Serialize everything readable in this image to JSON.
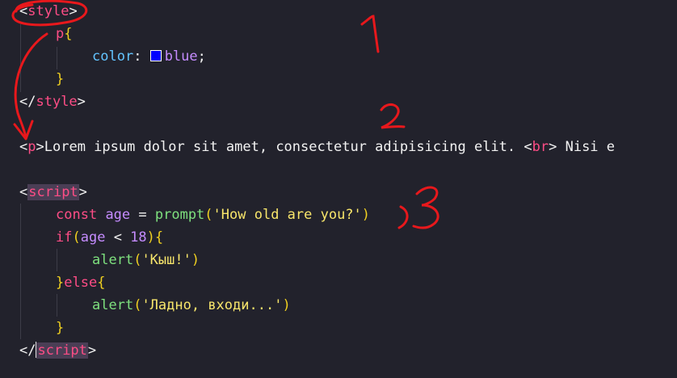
{
  "code": {
    "style_open_tag": "style",
    "selector": "p",
    "brace_open": "{",
    "property": "color",
    "colon": ":",
    "value": "blue",
    "semicolon": ";",
    "brace_close": "}",
    "style_close_tag": "style",
    "p_tag": "p",
    "paragraph_text_1": "Lorem ipsum dolor sit amet, consectetur adipisicing elit. ",
    "br_tag": "br",
    "paragraph_text_2": " Nisi e",
    "script_open_tag": "script",
    "const_kw": "const",
    "age_var": "age",
    "equals": " = ",
    "prompt_fn": "prompt",
    "prompt_arg": "'How old are you?'",
    "if_kw": "if",
    "less_than": " < ",
    "age_limit": "18",
    "alert_fn": "alert",
    "alert_arg_1": "'Кыш!'",
    "else_kw": "else",
    "alert_arg_2": "'Ладно, входи...'",
    "script_close_tag": "script"
  },
  "annotations": {
    "number_1": "1",
    "number_2": "2",
    "number_3": "3",
    "ink_color": "#e8181c"
  },
  "colors": {
    "background": "#22222c",
    "tag": "#ff4d86",
    "string": "#f8e66b",
    "function": "#7ee07e",
    "property": "#63c4ff",
    "variable": "#c58cff",
    "brace": "#f0d020",
    "swatch": "#0000ff"
  }
}
